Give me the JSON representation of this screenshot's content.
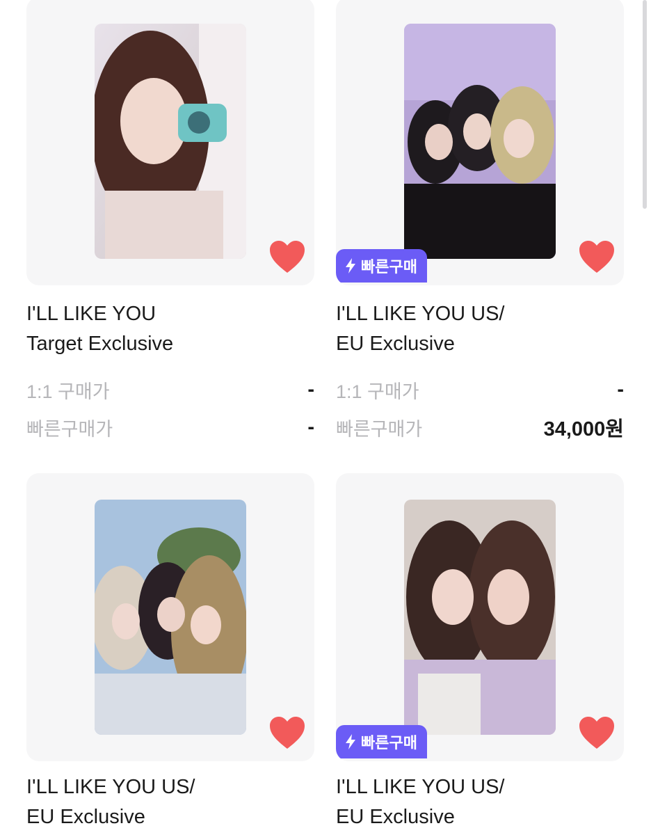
{
  "colors": {
    "accent": "#6b5cf6",
    "heart": "#f25a5a",
    "card_bg": "#f6f6f7",
    "muted": "#b5b5b8"
  },
  "products": [
    {
      "title_line1": "I'LL LIKE YOU",
      "title_line2": "Target Exclusive",
      "badge": "",
      "liked": true,
      "price_1to1_label": "1:1 구매가",
      "price_1to1_value": "-",
      "quick_label": "빠른구매가",
      "quick_value": "-"
    },
    {
      "title_line1": "I'LL LIKE YOU US/",
      "title_line2": "EU Exclusive",
      "badge": "빠른구매",
      "liked": true,
      "price_1to1_label": "1:1 구매가",
      "price_1to1_value": "-",
      "quick_label": "빠른구매가",
      "quick_value": "34,000원"
    },
    {
      "title_line1": "I'LL LIKE YOU US/",
      "title_line2": "EU Exclusive",
      "badge": "",
      "liked": true
    },
    {
      "title_line1": "I'LL LIKE YOU US/",
      "title_line2": "EU Exclusive",
      "badge": "빠른구매",
      "liked": true
    }
  ],
  "icons": {
    "heart": "heart-icon",
    "bolt": "lightning-icon"
  }
}
